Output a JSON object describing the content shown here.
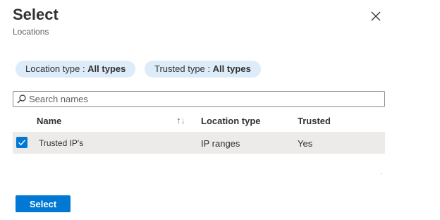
{
  "header": {
    "title": "Select",
    "subtitle": "Locations",
    "close_icon": "close-icon"
  },
  "filters": [
    {
      "label": "Location type : ",
      "value": "All types"
    },
    {
      "label": "Trusted type : ",
      "value": "All types"
    }
  ],
  "search": {
    "placeholder": "Search names",
    "value": "",
    "icon": "search-icon"
  },
  "table": {
    "columns": [
      "Name",
      "Location type",
      "Trusted"
    ],
    "sort_icon": "sort-arrows-icon",
    "rows": [
      {
        "selected": true,
        "name": "Trusted IP's",
        "location_type": "IP ranges",
        "trusted": "Yes"
      }
    ]
  },
  "footer": {
    "select_label": "Select"
  },
  "colors": {
    "accent": "#0078d4",
    "pill_bg": "#deecf9",
    "selected_row_bg": "#edebe9"
  }
}
